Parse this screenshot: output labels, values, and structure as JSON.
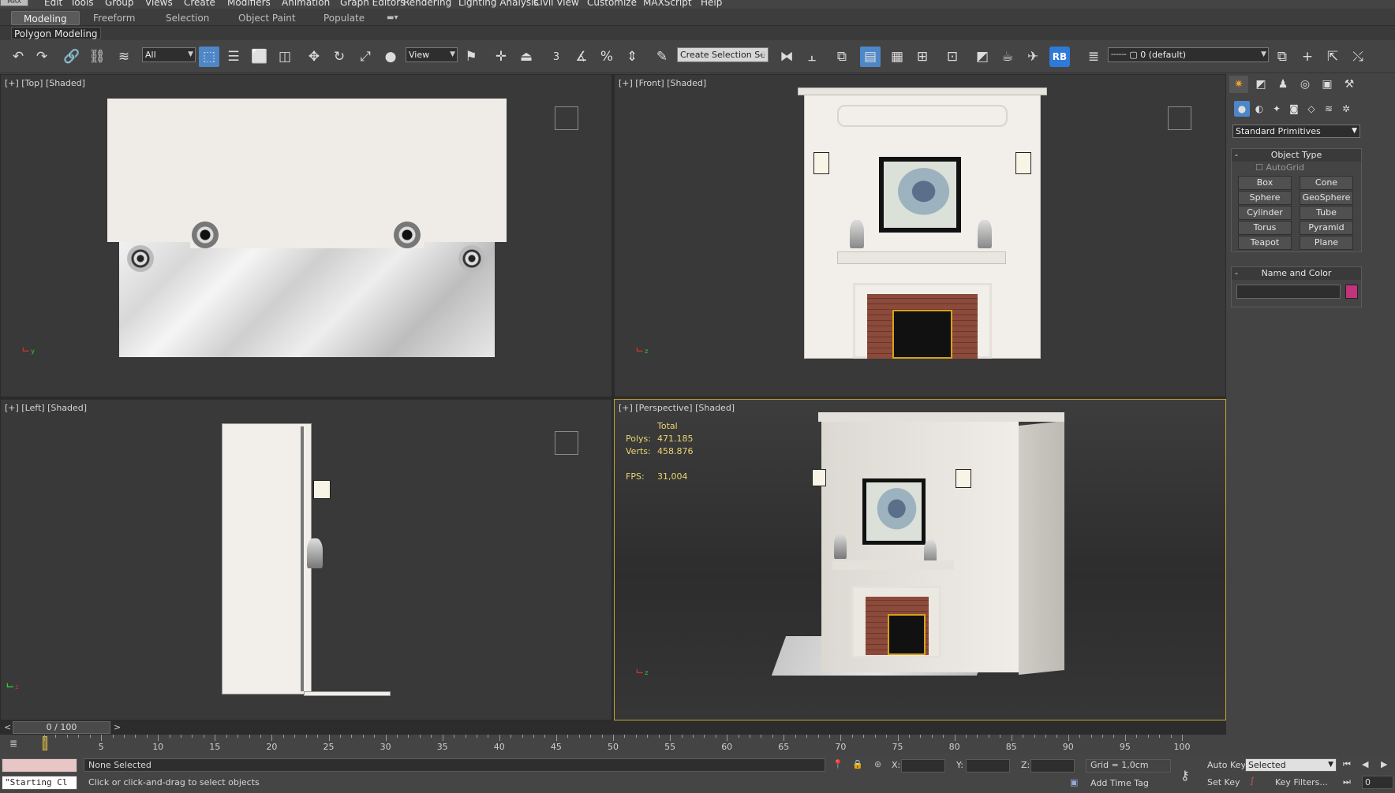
{
  "menu": {
    "logo": "MAX",
    "items": [
      "Edit",
      "Tools",
      "Group",
      "Views",
      "Create",
      "Modifiers",
      "Animation",
      "Graph Editors",
      "Rendering",
      "Lighting Analysis",
      "Civil View",
      "Customize",
      "MAXScript",
      "Help"
    ]
  },
  "ribbon": {
    "tabs": [
      "Modeling",
      "Freeform",
      "Selection",
      "Object Paint",
      "Populate"
    ],
    "active_tab": "Modeling",
    "panel_label": "Polygon Modeling"
  },
  "toolbar": {
    "selection_filter": "All",
    "ref_coord": "View",
    "named_selection_placeholder": "Create Selection Se",
    "snap_label": "3",
    "rb_label": "RB",
    "layer": "0 (default)"
  },
  "viewports": {
    "top": {
      "label": "[+] [Top] [Shaded]"
    },
    "front": {
      "label": "[+] [Front] [Shaded]"
    },
    "left": {
      "label": "[+] [Left] [Shaded]"
    },
    "perspective": {
      "label": "[+] [Perspective] [Shaded]"
    }
  },
  "stats": {
    "header": "Total",
    "polys_label": "Polys:",
    "polys": "471.185",
    "verts_label": "Verts:",
    "verts": "458.876",
    "fps_label": "FPS:",
    "fps": "31,004"
  },
  "command_panel": {
    "category": "Standard Primitives",
    "object_type_title": "Object Type",
    "autogrid_label": "AutoGrid",
    "buttons": [
      "Box",
      "Cone",
      "Sphere",
      "GeoSphere",
      "Cylinder",
      "Tube",
      "Torus",
      "Pyramid",
      "Teapot",
      "Plane"
    ],
    "name_color_title": "Name and Color",
    "color_swatch": "#c3337d"
  },
  "timeline": {
    "frame_display": "0 / 100",
    "prev": "<",
    "next": ">",
    "ticks": [
      "5",
      "10",
      "15",
      "20",
      "25",
      "30",
      "35",
      "40",
      "45",
      "50",
      "55",
      "60",
      "65",
      "70",
      "75",
      "80",
      "85",
      "90",
      "95",
      "100"
    ]
  },
  "status": {
    "script_listener": "\"Starting Cl",
    "selection": "None Selected",
    "prompt": "Click or click-and-drag to select objects",
    "x_label": "X:",
    "y_label": "Y:",
    "z_label": "Z:",
    "grid": "Grid = 1,0cm",
    "add_time_tag": "Add Time Tag",
    "auto_key": "Auto Key",
    "set_key": "Set Key",
    "key_mode": "Selected",
    "key_filters": "Key Filters...",
    "frame_value": "0"
  }
}
